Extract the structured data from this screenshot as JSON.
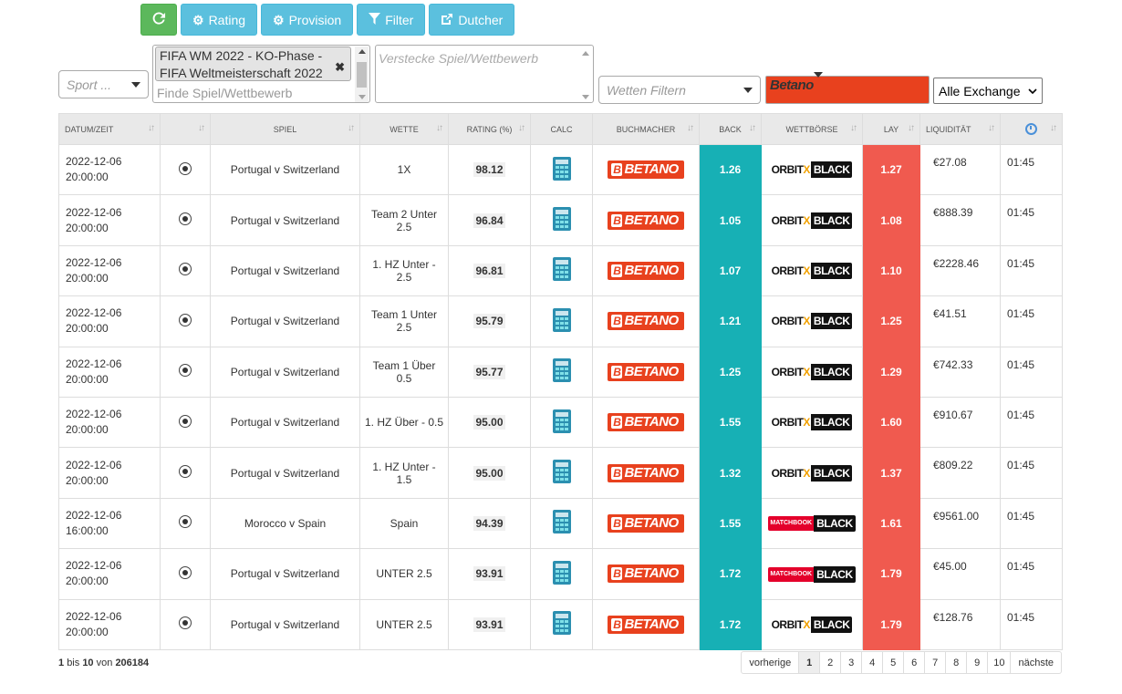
{
  "toolbar": {
    "refresh_icon": "refresh-icon",
    "buttons": [
      {
        "label": "Rating",
        "icon": "cogs-icon"
      },
      {
        "label": "Provision",
        "icon": "cogs-icon"
      },
      {
        "label": "Filter",
        "icon": "filter-icon"
      },
      {
        "label": "Dutcher",
        "icon": "external-link-icon"
      }
    ]
  },
  "filters": {
    "sport_placeholder": "Sport ...",
    "competition_tag": "FIFA WM 2022 - KO-Phase - FIFA Weltmeisterschaft 2022",
    "competition_tag_line1": "FIFA WM 2022 - KO-Phase -",
    "competition_tag_line2": "FIFA Weltmeisterschaft 2022",
    "find_placeholder": "Finde Spiel/Wettbewerb",
    "hide_placeholder": "Verstecke Spiel/Wettbewerb",
    "wetten_placeholder": "Wetten Filtern",
    "bookmaker_selected": "Betano",
    "exchange_selected": "Alle Exchange"
  },
  "table": {
    "headers": [
      "DATUM/ZEIT",
      "",
      "SPIEL",
      "WETTE",
      "RATING (%)",
      "CALC",
      "BUCHMACHER",
      "BACK",
      "WETTBÖRSE",
      "LAY",
      "LIQUIDITÄT",
      ""
    ],
    "rows": [
      {
        "date": "2022-12-06",
        "time": "20:00:00",
        "game": "Portugal v Switzerland",
        "bet": "1X",
        "rating": "98.12",
        "bookmaker": "BETANO",
        "back": "1.26",
        "exchange": "orbitx",
        "lay": "1.27",
        "liquidity": "€27.08",
        "age": "01:45"
      },
      {
        "date": "2022-12-06",
        "time": "20:00:00",
        "game": "Portugal v Switzerland",
        "bet": "Team 2 Unter 2.5",
        "rating": "96.84",
        "bookmaker": "BETANO",
        "back": "1.05",
        "exchange": "orbitx",
        "lay": "1.08",
        "liquidity": "€888.39",
        "age": "01:45"
      },
      {
        "date": "2022-12-06",
        "time": "20:00:00",
        "game": "Portugal v Switzerland",
        "bet": "1. HZ Unter - 2.5",
        "rating": "96.81",
        "bookmaker": "BETANO",
        "back": "1.07",
        "exchange": "orbitx",
        "lay": "1.10",
        "liquidity": "€2228.46",
        "age": "01:45"
      },
      {
        "date": "2022-12-06",
        "time": "20:00:00",
        "game": "Portugal v Switzerland",
        "bet": "Team 1 Unter 2.5",
        "rating": "95.79",
        "bookmaker": "BETANO",
        "back": "1.21",
        "exchange": "orbitx",
        "lay": "1.25",
        "liquidity": "€41.51",
        "age": "01:45"
      },
      {
        "date": "2022-12-06",
        "time": "20:00:00",
        "game": "Portugal v Switzerland",
        "bet": "Team 1 Über 0.5",
        "rating": "95.77",
        "bookmaker": "BETANO",
        "back": "1.25",
        "exchange": "orbitx",
        "lay": "1.29",
        "liquidity": "€742.33",
        "age": "01:45"
      },
      {
        "date": "2022-12-06",
        "time": "20:00:00",
        "game": "Portugal v Switzerland",
        "bet": "1. HZ Über - 0.5",
        "rating": "95.00",
        "bookmaker": "BETANO",
        "back": "1.55",
        "exchange": "orbitx",
        "lay": "1.60",
        "liquidity": "€910.67",
        "age": "01:45"
      },
      {
        "date": "2022-12-06",
        "time": "20:00:00",
        "game": "Portugal v Switzerland",
        "bet": "1. HZ Unter - 1.5",
        "rating": "95.00",
        "bookmaker": "BETANO",
        "back": "1.32",
        "exchange": "orbitx",
        "lay": "1.37",
        "liquidity": "€809.22",
        "age": "01:45"
      },
      {
        "date": "2022-12-06",
        "time": "16:00:00",
        "game": "Morocco v Spain",
        "bet": "Spain",
        "rating": "94.39",
        "bookmaker": "BETANO",
        "back": "1.55",
        "exchange": "matchbook",
        "lay": "1.61",
        "liquidity": "€9561.00",
        "age": "01:45"
      },
      {
        "date": "2022-12-06",
        "time": "20:00:00",
        "game": "Portugal v Switzerland",
        "bet": "UNTER 2.5",
        "rating": "93.91",
        "bookmaker": "BETANO",
        "back": "1.72",
        "exchange": "matchbook",
        "lay": "1.79",
        "liquidity": "€45.00",
        "age": "01:45"
      },
      {
        "date": "2022-12-06",
        "time": "20:00:00",
        "game": "Portugal v Switzerland",
        "bet": "UNTER 2.5",
        "rating": "93.91",
        "bookmaker": "BETANO",
        "back": "1.72",
        "exchange": "orbitx",
        "lay": "1.79",
        "liquidity": "€128.76",
        "age": "01:45"
      }
    ]
  },
  "logos": {
    "orbitx_text": "ORBIT",
    "orbitx_x": "X",
    "matchbook_text": "MATCHBOOK",
    "black_text": "BLACK"
  },
  "footer": {
    "info_from": "1",
    "info_bis": "bis",
    "info_to": "10",
    "info_von": "von",
    "info_total": "206184",
    "prev": "vorherige",
    "next": "nächste",
    "pages": [
      "1",
      "2",
      "3",
      "4",
      "5",
      "6",
      "7",
      "8",
      "9",
      "10"
    ],
    "active_page": "1"
  },
  "colors": {
    "back": "#17b0b5",
    "lay": "#f05a4f",
    "toolbar_green": "#5cb85c",
    "toolbar_blue": "#5bc0de",
    "betano": "#e8411e"
  }
}
